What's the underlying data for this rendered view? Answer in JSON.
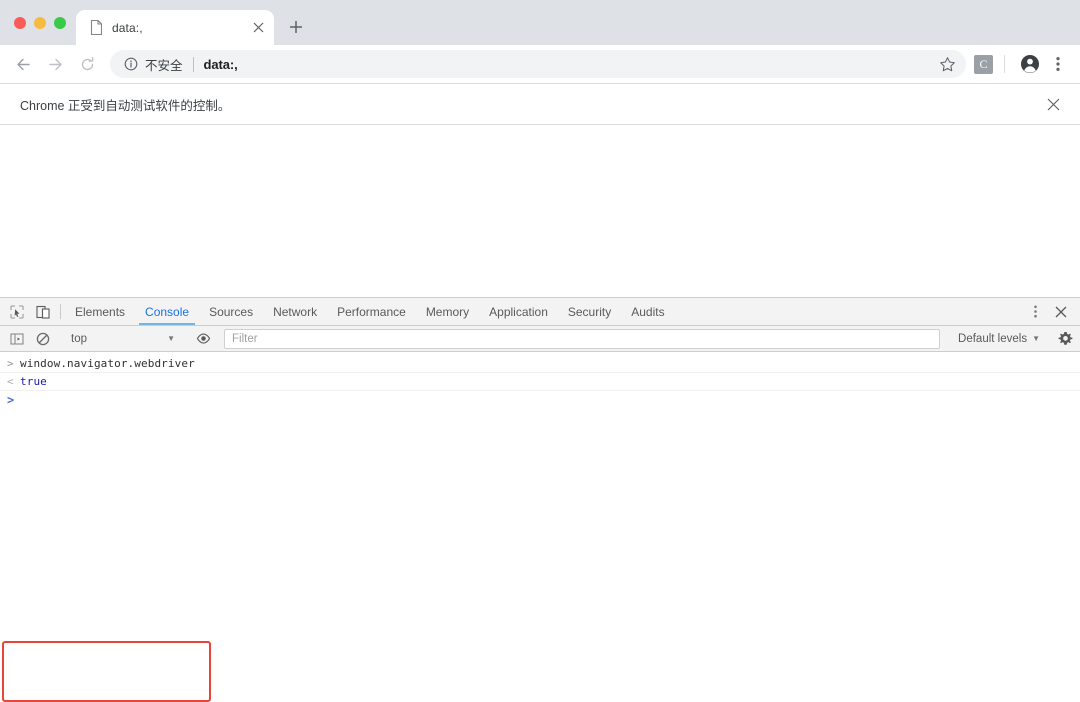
{
  "browser": {
    "window_controls": [
      "close",
      "minimize",
      "maximize"
    ],
    "tab": {
      "title": "data:,",
      "favicon": "document-icon",
      "close_label": "×"
    },
    "new_tab_label": "+",
    "toolbar": {
      "back_label": "←",
      "forward_label": "→",
      "reload_label": "↻",
      "security_text": "不安全",
      "url": "data:,",
      "star_label": "☆",
      "extension_label": "C",
      "avatar_label": "profile",
      "menu_label": "⋮"
    },
    "infobar": {
      "message": "Chrome 正受到自动测试软件的控制。",
      "close_label": "×"
    }
  },
  "devtools": {
    "tabs": [
      {
        "label": "Elements",
        "active": false
      },
      {
        "label": "Console",
        "active": true
      },
      {
        "label": "Sources",
        "active": false
      },
      {
        "label": "Network",
        "active": false
      },
      {
        "label": "Performance",
        "active": false
      },
      {
        "label": "Memory",
        "active": false
      },
      {
        "label": "Application",
        "active": false
      },
      {
        "label": "Security",
        "active": false
      },
      {
        "label": "Audits",
        "active": false
      }
    ],
    "inspect_icon": "inspect-element-icon",
    "device_icon": "device-toolbar-icon",
    "more_label": "⋮",
    "close_label": "×",
    "console_toolbar": {
      "sidebar_icon": "console-sidebar-icon",
      "clear_icon": "clear-console-icon",
      "context": "top",
      "context_caret": "▼",
      "eye_icon": "live-expression-icon",
      "filter_placeholder": "Filter",
      "levels": "Default levels",
      "levels_caret": "▼",
      "gear_icon": "settings-gear-icon"
    },
    "console_entries": [
      {
        "marker": ">",
        "text": "window.navigator.webdriver",
        "kind": "input"
      },
      {
        "marker": "<",
        "text": "true",
        "kind": "result"
      }
    ],
    "prompt_marker": ">"
  },
  "annotation": {
    "highlight_color": "#e8443a"
  }
}
